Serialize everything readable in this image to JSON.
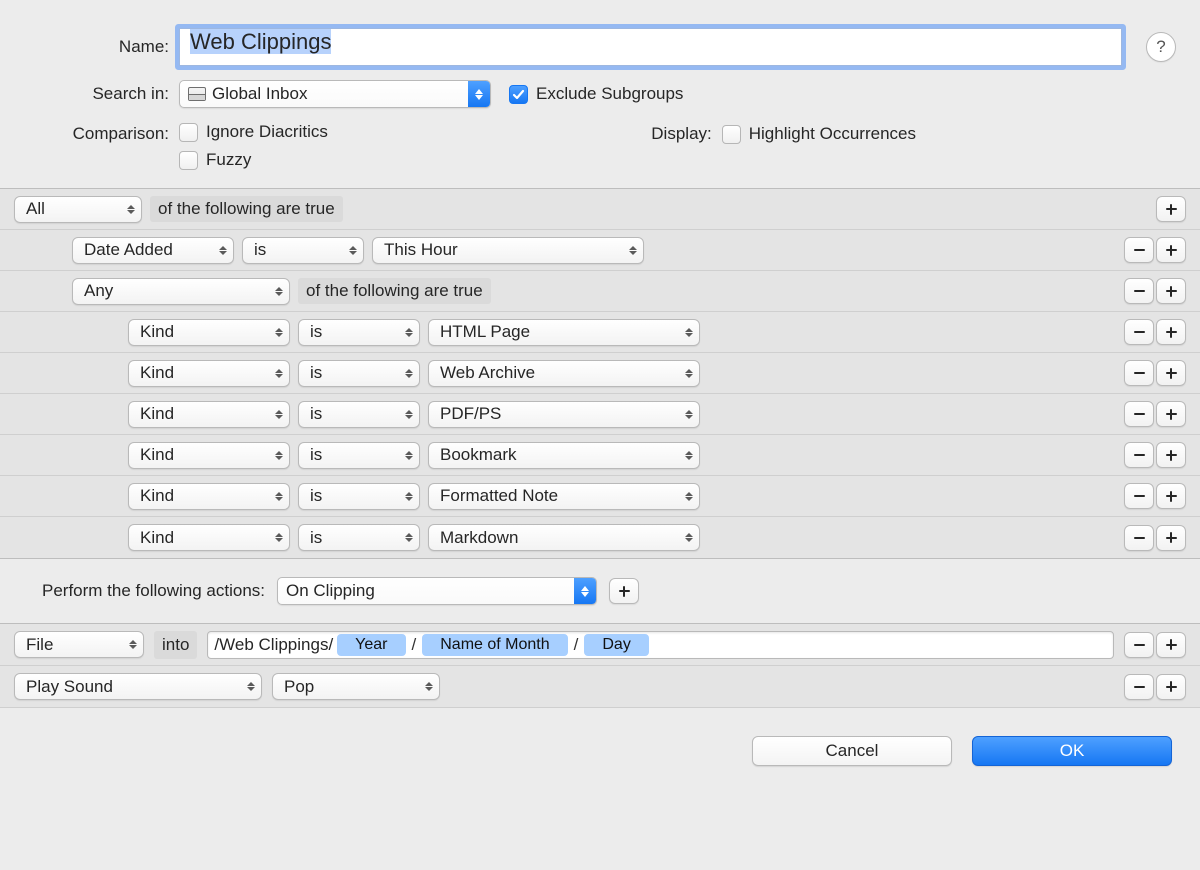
{
  "labels": {
    "name": "Name:",
    "search_in": "Search in:",
    "comparison": "Comparison:",
    "display": "Display:",
    "perform_actions": "Perform the following actions:"
  },
  "name_value": "Web Clippings",
  "help": "?",
  "search_in": {
    "icon": "inbox-icon",
    "value": "Global Inbox"
  },
  "exclude_subgroups": {
    "label": "Exclude Subgroups",
    "checked": true
  },
  "comparison": {
    "ignore": "Ignore Diacritics",
    "fuzzy": "Fuzzy"
  },
  "display": {
    "highlight": "Highlight Occurrences"
  },
  "predicate": {
    "compound_text": "of the following are true",
    "root": "All",
    "rows": [
      {
        "indent": 1,
        "field": "Date Added",
        "op": "is",
        "value": "This Hour",
        "minus": true,
        "plus": true
      },
      {
        "indent": 1,
        "compound": "Any",
        "minus": true,
        "plus": true
      },
      {
        "indent": 2,
        "field": "Kind",
        "op": "is",
        "value": "HTML Page",
        "minus": true,
        "plus": true
      },
      {
        "indent": 2,
        "field": "Kind",
        "op": "is",
        "value": "Web Archive",
        "minus": true,
        "plus": true
      },
      {
        "indent": 2,
        "field": "Kind",
        "op": "is",
        "value": "PDF/PS",
        "minus": true,
        "plus": true
      },
      {
        "indent": 2,
        "field": "Kind",
        "op": "is",
        "value": "Bookmark",
        "minus": true,
        "plus": true
      },
      {
        "indent": 2,
        "field": "Kind",
        "op": "is",
        "value": "Formatted Note",
        "minus": true,
        "plus": true
      },
      {
        "indent": 2,
        "field": "Kind",
        "op": "is",
        "value": "Markdown",
        "minus": true,
        "plus": true
      }
    ]
  },
  "trigger": {
    "value": "On Clipping"
  },
  "actions": {
    "file": {
      "verb": "File",
      "into": "into",
      "path_prefix": "/Web Clippings/",
      "tokens": [
        "Year",
        "Name of Month",
        "Day"
      ]
    },
    "sound": {
      "verb": "Play Sound",
      "value": "Pop"
    }
  },
  "buttons": {
    "cancel": "Cancel",
    "ok": "OK"
  }
}
